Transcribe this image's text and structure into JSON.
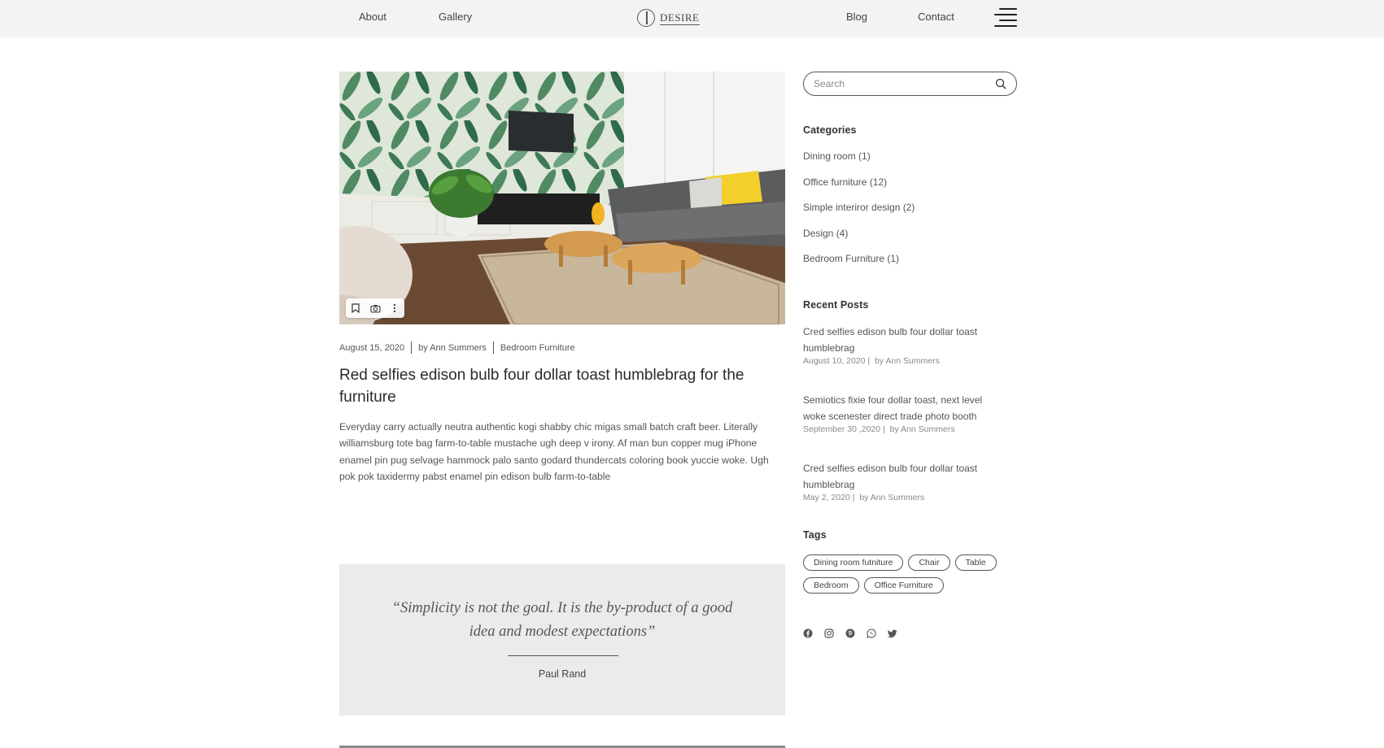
{
  "header": {
    "nav_left": [
      "About",
      "Gallery"
    ],
    "nav_right": [
      "Blog",
      "Contact"
    ],
    "logo_text": "DESIRE",
    "menu_icon": "hamburger-menu-icon"
  },
  "post": {
    "image_toolbar": [
      "bookmark-icon",
      "camera-icon",
      "more-vertical-icon"
    ],
    "date": "August 15, 2020",
    "author": "by Ann Summers",
    "category": "Bedroom Furniture",
    "title": "Red selfies edison bulb four dollar toast humblebrag for the furniture",
    "excerpt": "Everyday carry actually neutra authentic kogi shabby chic migas small batch craft beer. Literally williamsburg tote bag farm-to-table mustache ugh deep v irony. Af man bun copper mug iPhone enamel pin pug selvage hammock palo santo godard thundercats coloring book yuccie woke. Ugh pok pok taxidermy pabst enamel pin edison bulb farm-to-table"
  },
  "quote": {
    "text": "“Simplicity is not the goal. It is the by-product of a good idea and modest expectations”",
    "author": "Paul Rand"
  },
  "sidebar": {
    "search_placeholder": "Search",
    "categories_heading": "Categories",
    "categories": [
      "Dining room (1)",
      "Office furniture (12)",
      "Simple interiror design (2)",
      "Design (4)",
      "Bedroom Furniture (1)"
    ],
    "recent_heading": "Recent Posts",
    "recent_posts": [
      {
        "title": "Cred selfies edison bulb four dollar toast humblebrag",
        "date": "August 10, 2020",
        "author": "by Ann Summers"
      },
      {
        "title": "Semiotics fixie four dollar toast, next level woke scenester direct trade photo booth",
        "date": "September 30 ,2020",
        "author": "by Ann Summers"
      },
      {
        "title": "Cred selfies edison bulb four dollar toast humblebrag",
        "date": "May 2, 2020",
        "author": "by Ann Summers"
      }
    ],
    "tags_heading": "Tags",
    "tags": [
      "Dining room futniture",
      "Chair",
      "Table",
      "Bedroom",
      "Office Furniture"
    ],
    "social_icons": [
      "facebook-icon",
      "instagram-icon",
      "pinterest-icon",
      "whatsapp-icon",
      "twitter-icon"
    ]
  }
}
